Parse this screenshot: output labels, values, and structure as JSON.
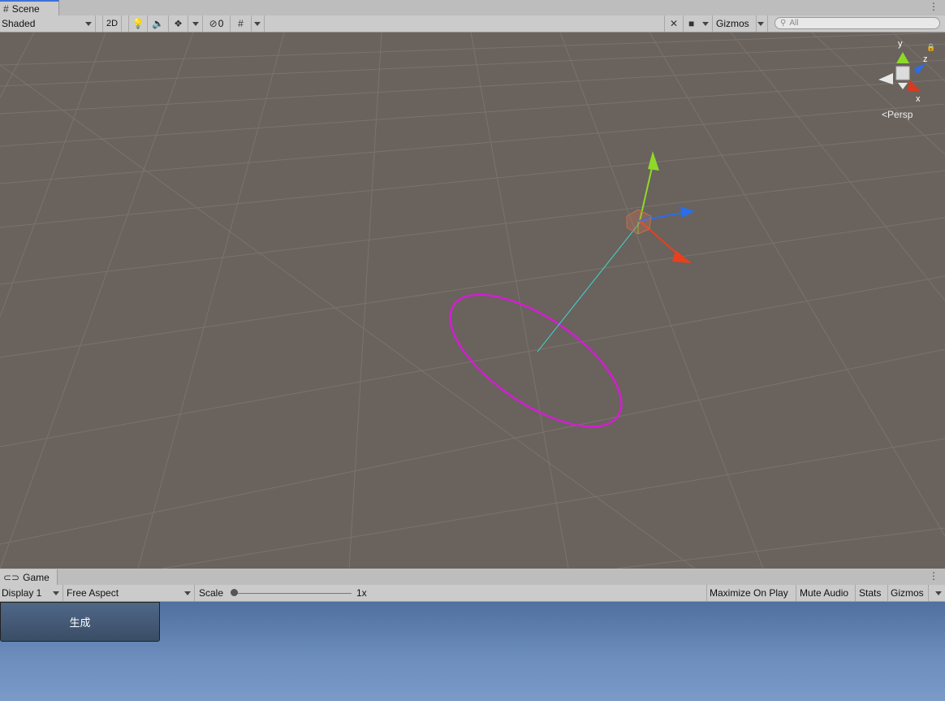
{
  "scene": {
    "tab_label": "Scene",
    "shading_mode": "Shaded",
    "mode_2d_label": "2D",
    "hidden_count": "0",
    "gizmos_label": "Gizmos",
    "search_placeholder": "All",
    "orientation": {
      "y": "y",
      "z": "z",
      "x": "x",
      "projection": "Persp"
    }
  },
  "game": {
    "tab_label": "Game",
    "display": "Display 1",
    "aspect": "Free Aspect",
    "scale_label": "Scale",
    "scale_value": "1x",
    "maximize_label": "Maximize On Play",
    "mute_label": "Mute Audio",
    "stats_label": "Stats",
    "gizmos_label": "Gizmos",
    "ui_button_label": "生成"
  },
  "colors": {
    "scene_bg": "#6a625c",
    "selection_circle": "#d21ed2",
    "axis_x": "#e8401e",
    "axis_y": "#8ed82a",
    "axis_z": "#2a6ee8",
    "ray": "#3ed8d8",
    "tab_accent": "#3a72d8"
  }
}
